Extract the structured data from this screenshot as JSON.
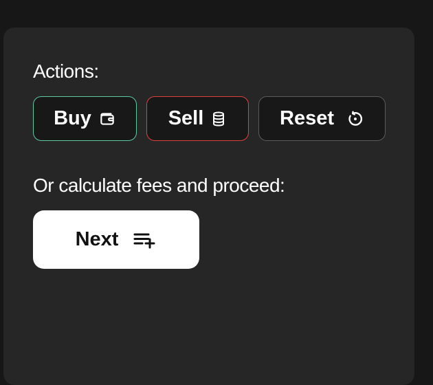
{
  "actions": {
    "label": "Actions:",
    "buy_label": "Buy",
    "sell_label": "Sell",
    "reset_label": "Reset",
    "buy_icon": "wallet-icon",
    "sell_icon": "database-icon",
    "reset_icon": "reset-icon",
    "buy_border_color": "#5ecba1",
    "sell_border_color": "#e0413f"
  },
  "fees": {
    "label": "Or calculate fees and proceed:",
    "next_label": "Next",
    "next_icon": "playlist-add-icon"
  }
}
